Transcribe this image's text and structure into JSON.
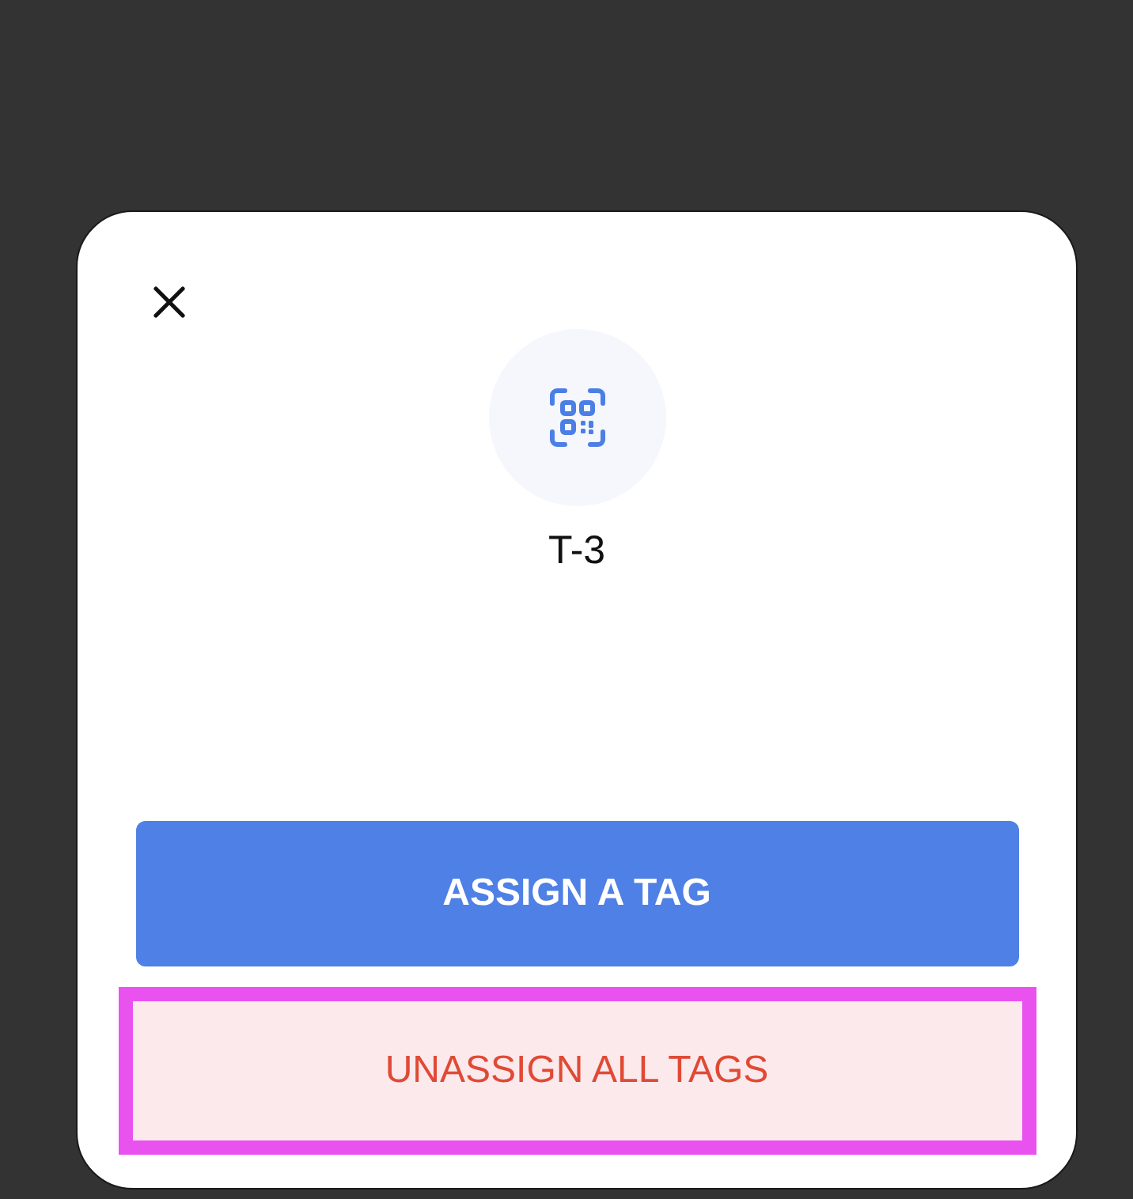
{
  "tag": {
    "label": "T-3"
  },
  "buttons": [
    {
      "label": "ASSIGN A TAG",
      "kind": "primary",
      "highlighted": false
    },
    {
      "label": "UNASSIGN ALL TAGS",
      "kind": "danger",
      "highlighted": true
    }
  ]
}
